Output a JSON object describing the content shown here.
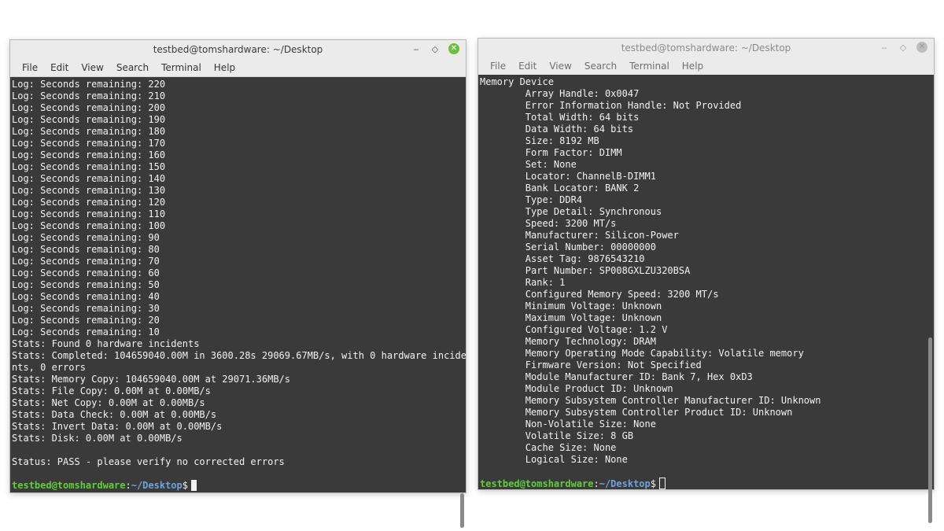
{
  "left_window": {
    "title": "testbed@tomshardware: ~/Desktop",
    "menu": [
      "File",
      "Edit",
      "View",
      "Search",
      "Terminal",
      "Help"
    ],
    "lines": [
      "Log: Seconds remaining: 220",
      "Log: Seconds remaining: 210",
      "Log: Seconds remaining: 200",
      "Log: Seconds remaining: 190",
      "Log: Seconds remaining: 180",
      "Log: Seconds remaining: 170",
      "Log: Seconds remaining: 160",
      "Log: Seconds remaining: 150",
      "Log: Seconds remaining: 140",
      "Log: Seconds remaining: 130",
      "Log: Seconds remaining: 120",
      "Log: Seconds remaining: 110",
      "Log: Seconds remaining: 100",
      "Log: Seconds remaining: 90",
      "Log: Seconds remaining: 80",
      "Log: Seconds remaining: 70",
      "Log: Seconds remaining: 60",
      "Log: Seconds remaining: 50",
      "Log: Seconds remaining: 40",
      "Log: Seconds remaining: 30",
      "Log: Seconds remaining: 20",
      "Log: Seconds remaining: 10",
      "Stats: Found 0 hardware incidents",
      "Stats: Completed: 104659040.00M in 3600.28s 29069.67MB/s, with 0 hardware incide",
      "nts, 0 errors",
      "Stats: Memory Copy: 104659040.00M at 29071.36MB/s",
      "Stats: File Copy: 0.00M at 0.00MB/s",
      "Stats: Net Copy: 0.00M at 0.00MB/s",
      "Stats: Data Check: 0.00M at 0.00MB/s",
      "Stats: Invert Data: 0.00M at 0.00MB/s",
      "Stats: Disk: 0.00M at 0.00MB/s",
      "",
      "Status: PASS - please verify no corrected errors",
      ""
    ],
    "prompt": {
      "user": "testbed@tomshardware",
      "sep": ":",
      "path": "~/Desktop",
      "dollar": "$"
    }
  },
  "right_window": {
    "title": "testbed@tomshardware: ~/Desktop",
    "menu": [
      "File",
      "Edit",
      "View",
      "Search",
      "Terminal",
      "Help"
    ],
    "lines": [
      "Memory Device",
      "        Array Handle: 0x0047",
      "        Error Information Handle: Not Provided",
      "        Total Width: 64 bits",
      "        Data Width: 64 bits",
      "        Size: 8192 MB",
      "        Form Factor: DIMM",
      "        Set: None",
      "        Locator: ChannelB-DIMM1",
      "        Bank Locator: BANK 2",
      "        Type: DDR4",
      "        Type Detail: Synchronous",
      "        Speed: 3200 MT/s",
      "        Manufacturer: Silicon-Power",
      "        Serial Number: 00000000",
      "        Asset Tag: 9876543210",
      "        Part Number: SP008GXLZU320BSA",
      "        Rank: 1",
      "        Configured Memory Speed: 3200 MT/s",
      "        Minimum Voltage: Unknown",
      "        Maximum Voltage: Unknown",
      "        Configured Voltage: 1.2 V",
      "        Memory Technology: DRAM",
      "        Memory Operating Mode Capability: Volatile memory",
      "        Firmware Version: Not Specified",
      "        Module Manufacturer ID: Bank 7, Hex 0xD3",
      "        Module Product ID: Unknown",
      "        Memory Subsystem Controller Manufacturer ID: Unknown",
      "        Memory Subsystem Controller Product ID: Unknown",
      "        Non-Volatile Size: None",
      "        Volatile Size: 8 GB",
      "        Cache Size: None",
      "        Logical Size: None",
      ""
    ],
    "prompt": {
      "user": "testbed@tomshardware",
      "sep": ":",
      "path": "~/Desktop",
      "dollar": "$"
    }
  },
  "window_controls": {
    "minimize": "‒",
    "restore": "◇",
    "close": "✕"
  },
  "colors": {
    "terminal_bg": "#3a3a3a",
    "prompt_user": "#5fd035",
    "prompt_path": "#6fa3e0",
    "close_active": "#6fbf3f"
  }
}
